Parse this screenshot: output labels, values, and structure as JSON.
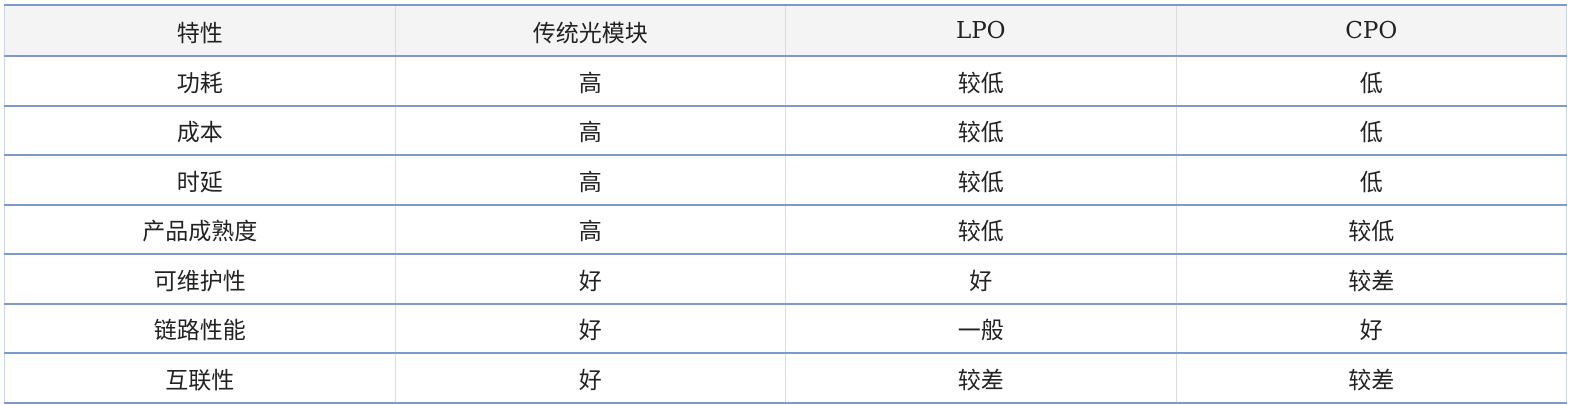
{
  "table": {
    "headers": [
      "特性",
      "传统光模块",
      "LPO",
      "CPO"
    ],
    "rows": [
      [
        "功耗",
        "高",
        "较低",
        "低"
      ],
      [
        "成本",
        "高",
        "较低",
        "低"
      ],
      [
        "时延",
        "高",
        "较低",
        "低"
      ],
      [
        "产品成熟度",
        "高",
        "较低",
        "较低"
      ],
      [
        "可维护性",
        "好",
        "好",
        "较差"
      ],
      [
        "链路性能",
        "好",
        "一般",
        "好"
      ],
      [
        "互联性",
        "好",
        "较差",
        "较差"
      ]
    ]
  },
  "colors": {
    "rule": "#7f9ac6",
    "header_bg": "#f4f4f4",
    "text": "#222222"
  }
}
